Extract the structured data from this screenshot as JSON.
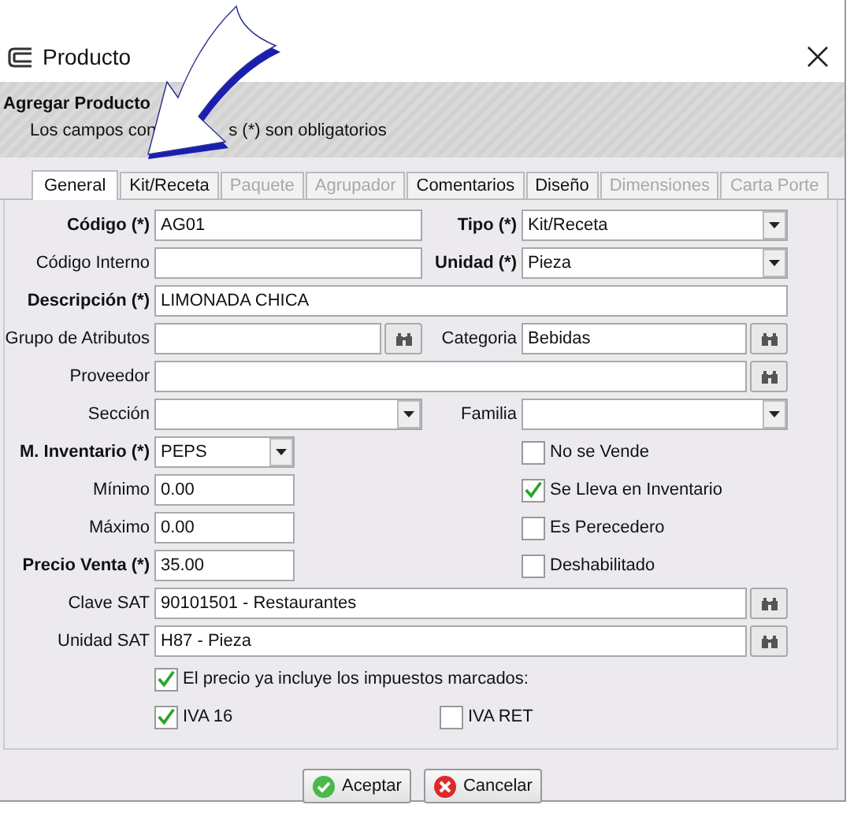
{
  "window": {
    "title": "Producto"
  },
  "header": {
    "title": "Agregar Producto",
    "subtitle_parts": [
      "Los campos con",
      "s (*) son obligatorios"
    ]
  },
  "tabs": [
    {
      "label": "General",
      "selected": true,
      "disabled": false
    },
    {
      "label": "Kit/Receta",
      "selected": false,
      "disabled": false
    },
    {
      "label": "Paquete",
      "selected": false,
      "disabled": true
    },
    {
      "label": "Agrupador",
      "selected": false,
      "disabled": true
    },
    {
      "label": "Comentarios",
      "selected": false,
      "disabled": false
    },
    {
      "label": "Diseño",
      "selected": false,
      "disabled": false
    },
    {
      "label": "Dimensiones",
      "selected": false,
      "disabled": true
    },
    {
      "label": "Carta Porte",
      "selected": false,
      "disabled": true
    }
  ],
  "rows": [
    {
      "left": {
        "kind": "text",
        "label": "Código (*)",
        "required": true,
        "value": "AG01"
      },
      "right": {
        "kind": "select",
        "label": "Tipo (*)",
        "required": true,
        "value": "Kit/Receta"
      }
    },
    {
      "left": {
        "kind": "text",
        "label": "Código Interno",
        "required": false
      },
      "right": {
        "kind": "select",
        "label": "Unidad (*)",
        "required": true,
        "value": "Pieza"
      }
    },
    {
      "full": {
        "kind": "text",
        "label": "Descripción (*)",
        "required": true,
        "value": "LIMONADA CHICA"
      }
    },
    {
      "left": {
        "kind": "lookup",
        "label": "Grupo de Atributos",
        "required": false
      },
      "right": {
        "kind": "lookup",
        "label": "Categoria",
        "required": false,
        "value": "Bebidas"
      }
    },
    {
      "full": {
        "kind": "lookup",
        "label": "Proveedor",
        "required": false
      }
    },
    {
      "left": {
        "kind": "select",
        "label": "Sección",
        "required": false
      },
      "right": {
        "kind": "select",
        "label": "Familia",
        "required": false
      }
    },
    {
      "left": {
        "kind": "select",
        "label": "M. Inventario (*)",
        "required": true,
        "value": "PEPS",
        "short": true
      },
      "right": {
        "kind": "checkbox",
        "label": "No se Vende",
        "checked": false
      }
    },
    {
      "left": {
        "kind": "text",
        "label": "Mínimo",
        "required": false,
        "value": "0.00",
        "short": true
      },
      "right": {
        "kind": "checkbox",
        "label": "Se Lleva en Inventario",
        "checked": true
      }
    },
    {
      "left": {
        "kind": "text",
        "label": "Máximo",
        "required": false,
        "value": "0.00",
        "short": true
      },
      "right": {
        "kind": "checkbox",
        "label": "Es Perecedero",
        "checked": false
      }
    },
    {
      "left": {
        "kind": "text",
        "label": "Precio Venta (*)",
        "required": true,
        "value": "35.00",
        "short": true
      },
      "right": {
        "kind": "checkbox",
        "label": "Deshabilitado",
        "checked": false
      }
    },
    {
      "full": {
        "kind": "lookup",
        "label": "Clave SAT",
        "required": false,
        "value": "90101501 - Restaurantes"
      }
    },
    {
      "full": {
        "kind": "lookup",
        "label": "Unidad SAT",
        "required": false,
        "value": "H87 - Pieza"
      }
    },
    {
      "wide": {
        "kind": "checkbox",
        "label": "El precio ya incluye los impuestos marcados:",
        "checked": true
      }
    },
    {
      "wide_left": {
        "kind": "checkbox",
        "label": "IVA 16",
        "checked": true
      },
      "middle": {
        "kind": "checkbox",
        "label": "IVA RET",
        "checked": false
      }
    }
  ],
  "buttons": [
    {
      "label": "Aceptar",
      "kind": "ok"
    },
    {
      "label": "Cancelar",
      "kind": "cancel"
    }
  ]
}
